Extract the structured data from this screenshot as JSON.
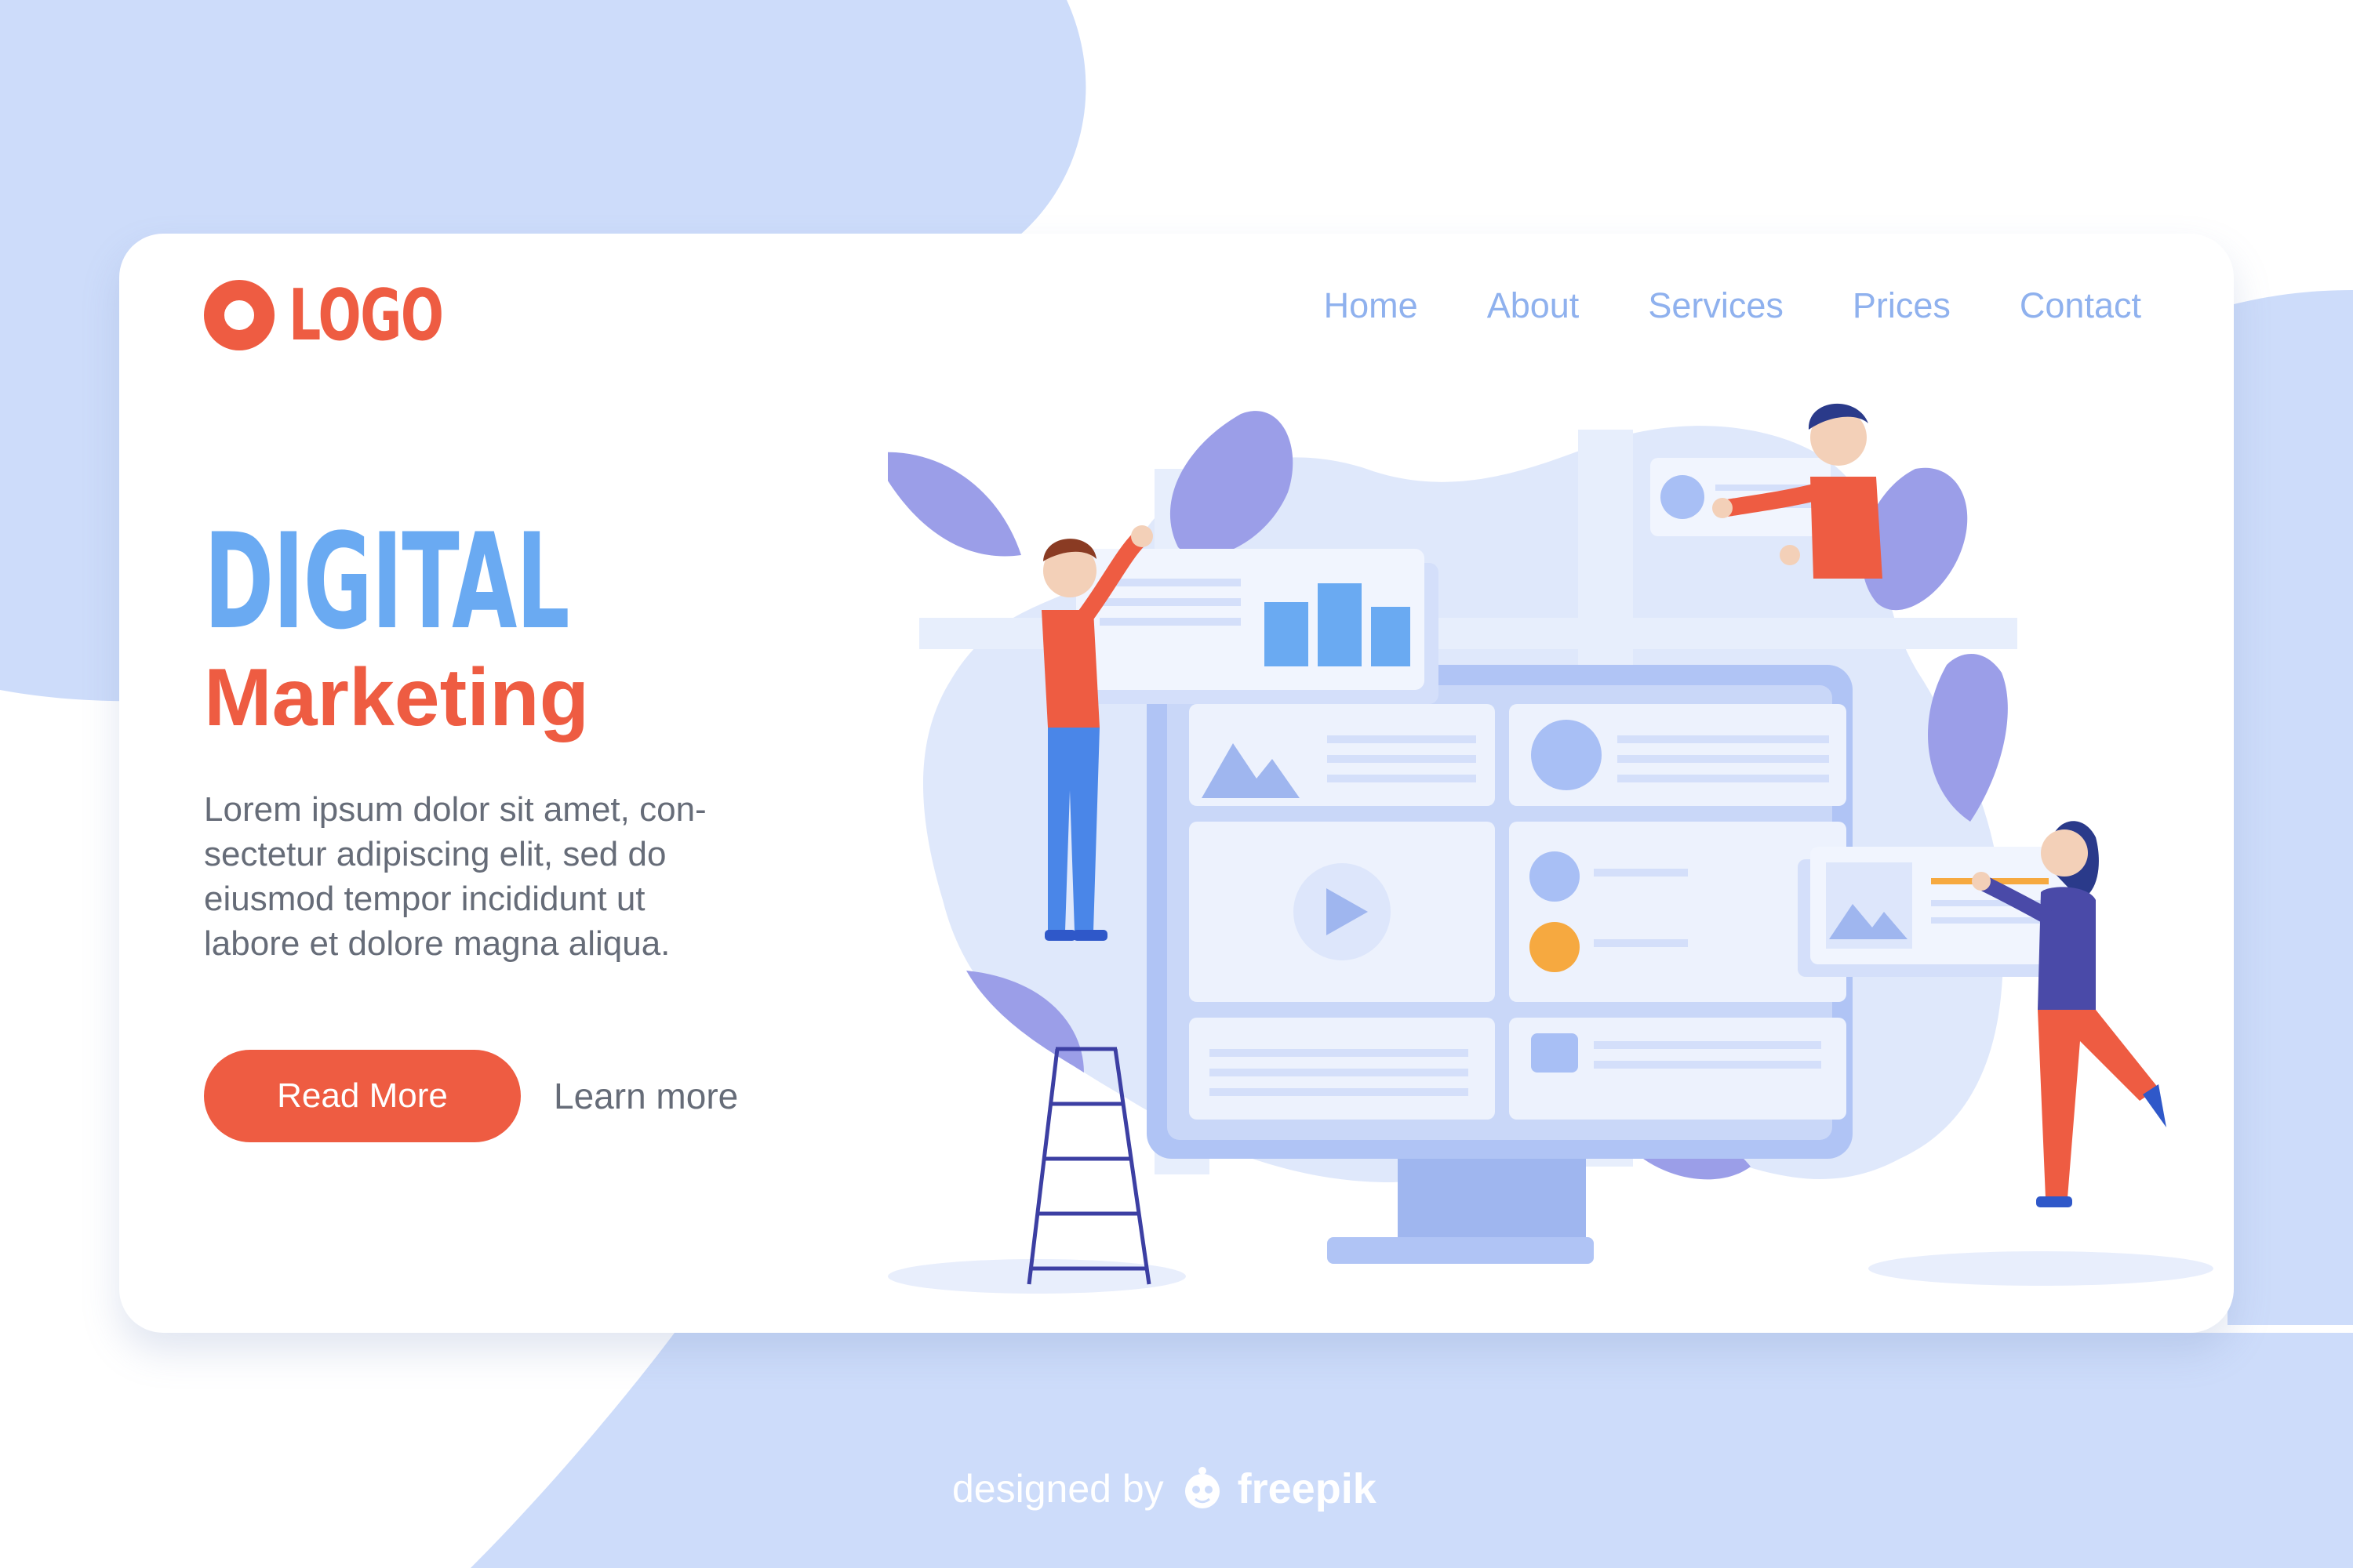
{
  "logo": {
    "text": "LOGO"
  },
  "nav": {
    "items": [
      {
        "label": "Home"
      },
      {
        "label": "About"
      },
      {
        "label": "Services"
      },
      {
        "label": "Prices"
      },
      {
        "label": "Contact"
      }
    ]
  },
  "hero": {
    "title": "DIGITAL",
    "subtitle": "Marketing",
    "body_lines": [
      "Lorem ipsum dolor sit amet, con-",
      "sectetur adipiscing elit, sed do",
      "eiusmod tempor incididunt ut",
      "labore et dolore magna aliqua."
    ],
    "primary_button": "Read More",
    "secondary_link": "Learn more"
  },
  "footer": {
    "prefix": "designed by",
    "brand": "freepik"
  },
  "colors": {
    "accent": "#ee5c42",
    "title_blue": "#6aaaf2",
    "nav_blue": "#8fb1ee",
    "background_blob": "#cddcfa",
    "body_text": "#666c78",
    "chart_bar": "#6aaaf2",
    "leaf_purple": "#9b9ee8"
  },
  "icons": {
    "logo": "ring-logo-icon",
    "play": "play-icon",
    "image": "image-placeholder-icon",
    "chart": "bar-chart-icon",
    "brand": "freepik-icon"
  }
}
